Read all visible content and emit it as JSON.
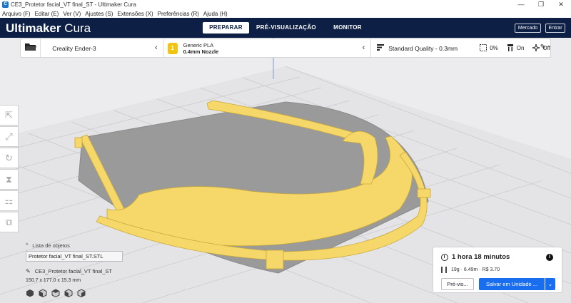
{
  "window": {
    "title": "CE3_Protetor facial_VT final_ST - Ultimaker Cura",
    "app_icon_glyph": "C",
    "controls": {
      "minimize": "—",
      "maximize": "❐",
      "close": "✕"
    }
  },
  "menu": [
    "Arquivo (F)",
    "Editar (E)",
    "Ver (V)",
    "Ajustes (S)",
    "Extensões (X)",
    "Preferências (R)",
    "Ajuda (H)"
  ],
  "header": {
    "brand_bold": "Ultimaker",
    "brand_light": " Cura",
    "tabs": [
      "PREPARAR",
      "PRÉ-VISUALIZAÇÃO",
      "MONITOR"
    ],
    "active_tab": "PREPARAR",
    "marketplace_label": "Mercado",
    "signin_label": "Entrar"
  },
  "toolbar": {
    "printer": "Creality Ender-3",
    "material_name": "Generic PLA",
    "nozzle": "0.4mm Nozzle",
    "material_badge": "1",
    "quality": "Standard Quality - 0.3mm",
    "infill": "0%",
    "support": "On",
    "adhesion": "Off"
  },
  "objects": {
    "list_title": "Lista de objetos",
    "items": [
      "Protetor facial_VT final_ST.STL"
    ],
    "selected_name": "CE3_Protetor facial_VT final_ST",
    "dimensions": "150.7 x 177.0 x 15.3 mm"
  },
  "print": {
    "time": "1 hora 18 minutos",
    "stats": "19g · 6.49m · R$ 3.70",
    "preview_label": "Pré-vis...",
    "save_label": "Salvar em Unidade ..."
  },
  "colors": {
    "header_bg": "#0d1f44",
    "accent_blue": "#196ef0",
    "model_yellow": "#f6d76a",
    "plate_gray": "#9a9a9a",
    "material_badge": "#f1c40f"
  }
}
